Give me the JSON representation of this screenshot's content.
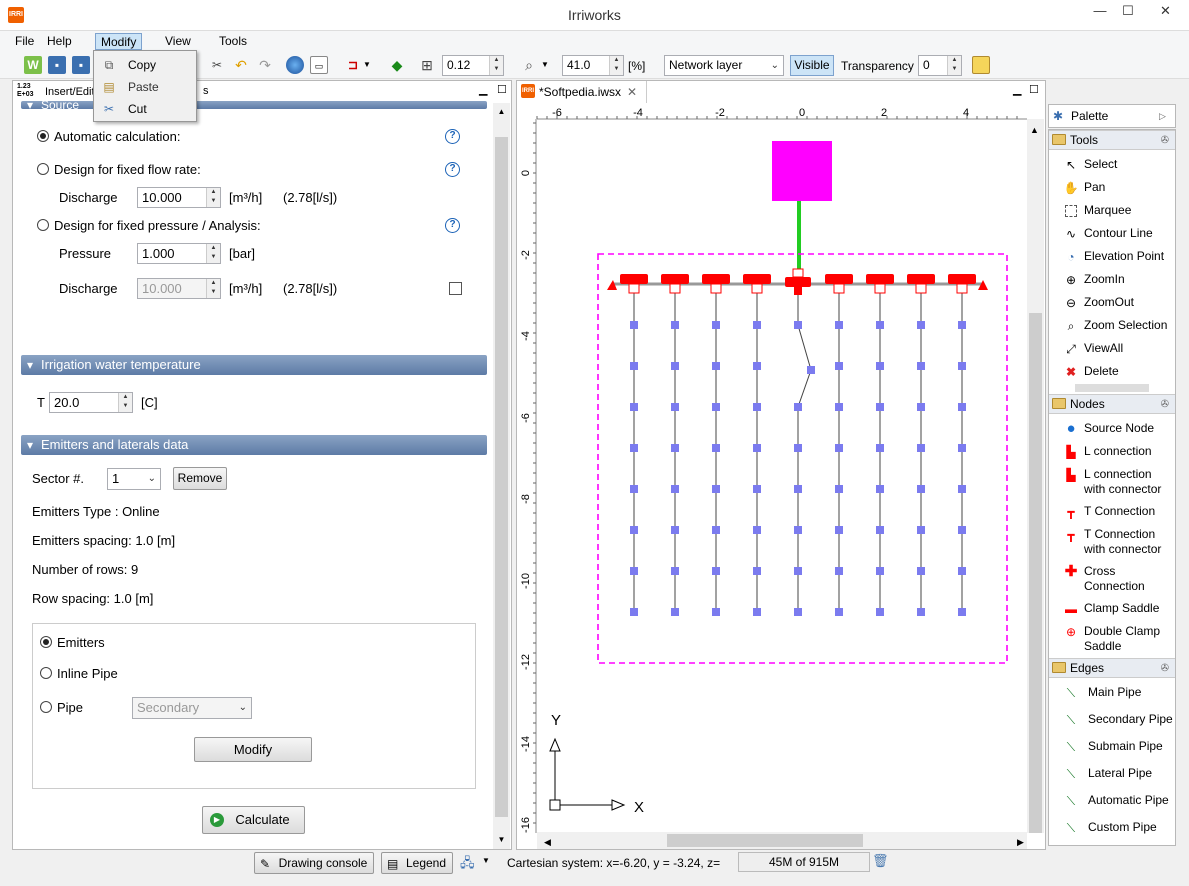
{
  "window": {
    "title": "Irriworks",
    "app_icon": "IRRI",
    "minimize": "—",
    "maximize": "☐",
    "close": "✕"
  },
  "menubar": [
    "File",
    "Help",
    "Modify",
    "View",
    "Tools"
  ],
  "modify_menu": {
    "items": [
      {
        "label": "Copy",
        "icon": "copy-icon"
      },
      {
        "label": "Paste",
        "icon": "paste-icon"
      },
      {
        "label": "Cut",
        "icon": "scissors-icon"
      }
    ]
  },
  "toolbar": {
    "grid_value": "0.12",
    "zoom_value": "41.0",
    "zoom_unit": "[%]",
    "layer_select": "Network layer",
    "visible_label": "Visible",
    "transparency_label": "Transparency",
    "transparency_value": "0"
  },
  "left_panel": {
    "tab_label": "Insert/Edit",
    "tab_suffix": "s",
    "tab_icon_text": "1.23\nE+03",
    "source_title": "Source",
    "auto_calc": "Automatic calculation:",
    "fixed_flow": "Design for fixed flow rate:",
    "discharge_label": "Discharge",
    "discharge_value": "10.000",
    "discharge_unit": "[m³/h]",
    "discharge_conv": "(2.78[l/s])",
    "fixed_pressure": "Design for fixed pressure / Analysis:",
    "pressure_label": "Pressure",
    "pressure_value": "1.000",
    "pressure_unit": "[bar]",
    "discharge2_label": "Discharge",
    "discharge2_value": "10.000",
    "discharge2_unit": "[m³/h]",
    "discharge2_conv": "(2.78[l/s])",
    "temp_title": "Irrigation water temperature",
    "temp_label": "T",
    "temp_value": "20.0",
    "temp_unit": "[C]",
    "emitters_title": "Emitters and laterals data",
    "sector_label": "Sector #.",
    "sector_value": "1",
    "remove_label": "Remove",
    "emitter_type": "Emitters Type : Online",
    "emitter_spacing": "Emitters spacing: 1.0 [m]",
    "rows": "Number of rows: 9",
    "row_spacing": "Row spacing: 1.0 [m]",
    "opt_emitters": "Emitters",
    "opt_inline": "Inline Pipe",
    "opt_pipe": "Pipe",
    "pipe_select": "Secondary",
    "modify_label": "Modify",
    "calculate_label": "Calculate"
  },
  "editor": {
    "tab_label": "*Softpedia.iwsx",
    "h_ruler": [
      "-6",
      "-4",
      "-2",
      "0",
      "2",
      "4"
    ],
    "v_ruler": [
      "0",
      "-2",
      "-4",
      "-6",
      "-8",
      "-10",
      "-12",
      "-14",
      "-16"
    ],
    "axis_y": "Y",
    "axis_x": "X"
  },
  "palette": {
    "title": "Palette",
    "sections": [
      {
        "title": "Tools",
        "items": [
          {
            "label": "Select",
            "icon": "pointer-icon"
          },
          {
            "label": "Pan",
            "icon": "hand-icon"
          },
          {
            "label": "Marquee",
            "icon": "marquee-icon"
          },
          {
            "label": "Contour Line",
            "icon": "contour-icon"
          },
          {
            "label": "Elevation Point",
            "icon": "elevation-icon"
          },
          {
            "label": "ZoomIn",
            "icon": "zoom-in-icon"
          },
          {
            "label": "ZoomOut",
            "icon": "zoom-out-icon"
          },
          {
            "label": "Zoom Selection",
            "icon": "zoom-selection-icon"
          },
          {
            "label": "ViewAll",
            "icon": "view-all-icon"
          },
          {
            "label": "Delete",
            "icon": "delete-icon"
          }
        ]
      },
      {
        "title": "Nodes",
        "items": [
          {
            "label": "Source Node",
            "icon": "source-node-icon"
          },
          {
            "label": "L connection",
            "icon": "l-connection-icon"
          },
          {
            "label": "L connection with connector",
            "icon": "l-connector-icon"
          },
          {
            "label": "T Connection",
            "icon": "t-connection-icon"
          },
          {
            "label": "T Connection with connector",
            "icon": "t-connector-icon"
          },
          {
            "label": "Cross Connection",
            "icon": "cross-connection-icon"
          },
          {
            "label": "Clamp Saddle",
            "icon": "clamp-saddle-icon"
          },
          {
            "label": "Double Clamp Saddle",
            "icon": "double-clamp-icon"
          }
        ]
      },
      {
        "title": "Edges",
        "items": [
          {
            "label": "Main Pipe",
            "icon": "pipe-icon"
          },
          {
            "label": "Secondary Pipe",
            "icon": "pipe-icon"
          },
          {
            "label": "Submain Pipe",
            "icon": "pipe-icon"
          },
          {
            "label": "Lateral Pipe",
            "icon": "pipe-icon"
          },
          {
            "label": "Automatic Pipe",
            "icon": "pipe-icon"
          },
          {
            "label": "Custom Pipe",
            "icon": "pipe-icon"
          }
        ]
      }
    ]
  },
  "statusbar": {
    "drawing_console": "Drawing console",
    "legend": "Legend",
    "coords": "Cartesian system: x=-6.20, y = -3.24, z=",
    "memory": "45M of 915M"
  },
  "colors": {
    "accent": "#cce4f7",
    "source_node": "#ff00ff",
    "main_pipe": "#22cc22",
    "connection": "#ff0000",
    "emitter": "#7b7bef",
    "selection": "#ff00ff"
  }
}
